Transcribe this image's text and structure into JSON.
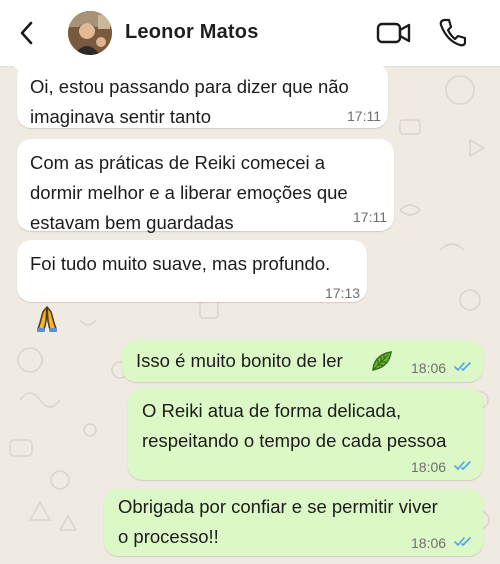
{
  "header": {
    "contact_name": "Leonor Matos"
  },
  "messages": [
    {
      "direction": "in",
      "lines": [
        "Oi, estou passando para dizer que não",
        "imaginava sentir tanto"
      ],
      "time": "17:11"
    },
    {
      "direction": "in",
      "lines": [
        "Com as práticas de Reiki comecei a",
        "dormir melhor e a liberar emoções que",
        "estavam bem guardadas"
      ],
      "time": "17:11"
    },
    {
      "direction": "in",
      "lines": [
        "Foi tudo muito suave, mas profundo."
      ],
      "time": "17:13"
    },
    {
      "direction": "out",
      "lines": [
        "Isso é muito bonito de ler"
      ],
      "time": "18:06"
    },
    {
      "direction": "out",
      "lines": [
        "O Reiki atua de forma delicada,",
        "respeitando o tempo de cada pessoa"
      ],
      "time": "18:06"
    },
    {
      "direction": "out",
      "lines": [
        "Obrigada por confiar e se permitir viver",
        "o processo!!"
      ],
      "time": "18:06"
    }
  ],
  "icons": {
    "back": "chevron-left-icon",
    "video": "video-camera-icon",
    "call": "phone-icon",
    "reaction": "praying-hands-emoji",
    "leaf": "leaf-emoji",
    "read_receipt": "double-check-icon"
  },
  "colors": {
    "incoming_bubble": "#ffffff",
    "outgoing_bubble": "#dcf8c6",
    "read_ticks": "#4fa6e8",
    "chat_background": "#efeae2"
  }
}
